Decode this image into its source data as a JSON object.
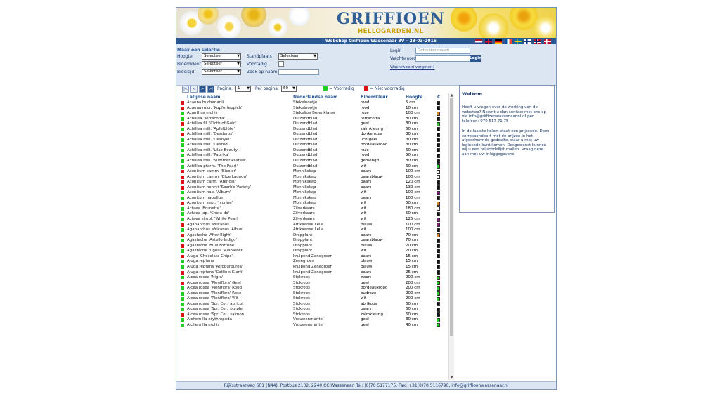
{
  "brand": {
    "logo_main": "GRIFFIOEN",
    "logo_sub": "HELLOGARDEN.NL"
  },
  "shopbar": {
    "title": "Webshop Griffioen Wassenaar BV  –  23-03-2015"
  },
  "flags": [
    "nl",
    "en",
    "de",
    "fr",
    "se",
    "fi",
    "no",
    "dk"
  ],
  "filters": {
    "section_title": "Maak een selectie",
    "hoogte_label": "Hoogte",
    "bloemkleur_label": "Bloemkleur",
    "bloeitijd_label": "Bloeitijd",
    "standplaats_label": "Standplaats",
    "voorradig_label": "Voorradig",
    "zoek_label": "Zoek op naam",
    "select_value": "Selecteer"
  },
  "login": {
    "login_label": "Login",
    "login_placeholder": "Gebruikersnaam",
    "password_label": "Wachtwoord",
    "button": "Login",
    "forgot": "Wachtwoord vergeten?"
  },
  "pager": {
    "first": "|<",
    "prev": "<",
    "next": ">",
    "last": ">|",
    "page_label": "Pagina:",
    "page_value": "1",
    "per_page_label": "Per pagina:",
    "per_page_value": "50",
    "legend_in_stock": "= Voorradig",
    "legend_not_in_stock": "= Niet voorradig",
    "colors": {
      "in_stock": "#22cc22",
      "not_in_stock": "#dd1111"
    }
  },
  "table": {
    "headers": {
      "latin": "Latijnse naam",
      "dutch": "Nederlandse naam",
      "color": "Bloemkleur",
      "height": "Hoogte",
      "extra": "C"
    },
    "rows": [
      {
        "s": "r",
        "latin": "Acaena buchananii",
        "dutch": "Stekelnootje",
        "color": "rood",
        "height": "5 cm",
        "sw": "#111111"
      },
      {
        "s": "r",
        "latin": "Acaena micr. 'Kupferteppich'",
        "dutch": "Stekelnootje",
        "color": "rood",
        "height": "10 cm",
        "sw": "#111111"
      },
      {
        "s": "g",
        "latin": "Acanthus mollis",
        "dutch": "Stekelige Berenklauw",
        "color": "roze",
        "height": "100 cm",
        "sw": "#d98a1a"
      },
      {
        "s": "g",
        "latin": "Achillea 'Terracotta'",
        "dutch": "Duizendblad",
        "color": "terracotta",
        "height": "80 cm",
        "sw": "#111111"
      },
      {
        "s": "r",
        "latin": "Achillea fil. 'Cloth of Gold'",
        "dutch": "Duizendblad",
        "color": "geel",
        "height": "80 cm",
        "sw": "#22cc22"
      },
      {
        "s": "g",
        "latin": "Achillea mill. 'Apfelblüte'",
        "dutch": "Duizendblad",
        "color": "zalmkleurig",
        "height": "50 cm",
        "sw": "#111111"
      },
      {
        "s": "r",
        "latin": "Achillea mill. 'Desderos'",
        "dutch": "Duizendblad",
        "color": "donkerroze",
        "height": "30 cm",
        "sw": "#111111"
      },
      {
        "s": "g",
        "latin": "Achillea mill. 'Deshyel'",
        "dutch": "Duizendblad",
        "color": "lichtgeel",
        "height": "30 cm",
        "sw": "#111111"
      },
      {
        "s": "g",
        "latin": "Achillea mill. 'Desred'",
        "dutch": "Duizendblad",
        "color": "bordeauxrood",
        "height": "30 cm",
        "sw": "#111111"
      },
      {
        "s": "g",
        "latin": "Achillea mill. 'Lilac Beauty'",
        "dutch": "Duizendblad",
        "color": "roze",
        "height": "60 cm",
        "sw": "#111111"
      },
      {
        "s": "g",
        "latin": "Achillea mill. 'Paprika'",
        "dutch": "Duizendblad",
        "color": "rood",
        "height": "50 cm",
        "sw": "#111111"
      },
      {
        "s": "g",
        "latin": "Achillea mill. 'Summer Pastels'",
        "dutch": "Duizendblad",
        "color": "gemengd",
        "height": "80 cm",
        "sw": "#111111"
      },
      {
        "s": "g",
        "latin": "Achillea ptarm. 'The Pearl'",
        "dutch": "Duizendblad",
        "color": "wit",
        "height": "60 cm",
        "sw": "#22cc22"
      },
      {
        "s": "r",
        "latin": "Aconitum camm. 'Bicolor'",
        "dutch": "Monnikskap",
        "color": "paars",
        "height": "100 cm",
        "sw": "#ffffff"
      },
      {
        "s": "r",
        "latin": "Aconitum camm. 'Blue Lagoon'",
        "dutch": "Monnikskap",
        "color": "paarsblauw",
        "height": "100 cm",
        "sw": "#ffffff"
      },
      {
        "s": "r",
        "latin": "Aconitum carm. 'Arendsii'",
        "dutch": "Monnikskap",
        "color": "paars",
        "height": "120 cm",
        "sw": "#111111"
      },
      {
        "s": "r",
        "latin": "Aconitum henryi 'Spark's Variety'",
        "dutch": "Monnikskap",
        "color": "paars",
        "height": "130 cm",
        "sw": "#111111"
      },
      {
        "s": "g",
        "latin": "Aconitum nap. 'Album'",
        "dutch": "Monnikskap",
        "color": "wit",
        "height": "100 cm",
        "sw": "#7b1f7b"
      },
      {
        "s": "g",
        "latin": "Aconitum napellus",
        "dutch": "Monnikskap",
        "color": "paars",
        "height": "100 cm",
        "sw": "#111111"
      },
      {
        "s": "r",
        "latin": "Aconitum sept. 'Ivorine'",
        "dutch": "Monnikskap",
        "color": "wit",
        "height": "50 cm",
        "sw": "#d98a1a"
      },
      {
        "s": "g",
        "latin": "Actaea 'Brunette'",
        "dutch": "Zilverkaars",
        "color": "wit",
        "height": "180 cm",
        "sw": "#ffffff"
      },
      {
        "s": "g",
        "latin": "Actaea jap. 'Cheju-do'",
        "dutch": "Zilverkaars",
        "color": "wit",
        "height": "50 cm",
        "sw": "#111111"
      },
      {
        "s": "g",
        "latin": "Actaea simpl. 'White Pearl'",
        "dutch": "Zilverkaars",
        "color": "wit",
        "height": "125 cm",
        "sw": "#7b1f7b"
      },
      {
        "s": "r",
        "latin": "Agapanthus africanus",
        "dutch": "Afrikaanse Lelie",
        "color": "blauw",
        "height": "100 cm",
        "sw": "#7b1f7b"
      },
      {
        "s": "g",
        "latin": "Agapanthus africanus 'Albus'",
        "dutch": "Afrikaanse Lelie",
        "color": "wit",
        "height": "100 cm",
        "sw": "#111111"
      },
      {
        "s": "r",
        "latin": "Agastache 'After Eight'",
        "dutch": "Dropplant",
        "color": "paars",
        "height": "70 cm",
        "sw": "#d98a1a"
      },
      {
        "s": "g",
        "latin": "Agastache 'Astello Indigo'",
        "dutch": "Dropplant",
        "color": "paarsblauw",
        "height": "70 cm",
        "sw": "#111111"
      },
      {
        "s": "r",
        "latin": "Agastache 'Blue Fortune'",
        "dutch": "Dropplant",
        "color": "blauw",
        "height": "70 cm",
        "sw": "#111111"
      },
      {
        "s": "g",
        "latin": "Agastache rugosa 'Alabaster'",
        "dutch": "Dropplant",
        "color": "wit",
        "height": "70 cm",
        "sw": "#111111"
      },
      {
        "s": "r",
        "latin": "Ajuga 'Chocolate Chips'",
        "dutch": "kruipend Zenegroen",
        "color": "paars",
        "height": "15 cm",
        "sw": "#111111"
      },
      {
        "s": "g",
        "latin": "Ajuga reptans",
        "dutch": "Zenegroen",
        "color": "blauw",
        "height": "15 cm",
        "sw": "#111111"
      },
      {
        "s": "g",
        "latin": "Ajuga reptans 'Atropurpurea'",
        "dutch": "kruipend Zenegroen",
        "color": "blauw",
        "height": "15 cm",
        "sw": "#111111"
      },
      {
        "s": "r",
        "latin": "Ajuga reptans 'Catlin's Giant'",
        "dutch": "kruipend Zenegroen",
        "color": "paars",
        "height": "25 cm",
        "sw": "#111111"
      },
      {
        "s": "g",
        "latin": "Alcea rosea 'Nigra'",
        "dutch": "Stokroos",
        "color": "zwart",
        "height": "200 cm",
        "sw": "#22cc22"
      },
      {
        "s": "r",
        "latin": "Alcea rosea 'Pleniflora' Geel",
        "dutch": "Stokroos",
        "color": "geel",
        "height": "200 cm",
        "sw": "#22cc22"
      },
      {
        "s": "g",
        "latin": "Alcea rosea 'Pleniflora' Rood",
        "dutch": "Stokroos",
        "color": "bordeauxrood",
        "height": "200 cm",
        "sw": "#22cc22"
      },
      {
        "s": "g",
        "latin": "Alcea rosea 'Pleniflora' Rose",
        "dutch": "Stokroos",
        "color": "oudroze",
        "height": "200 cm",
        "sw": "#22cc22"
      },
      {
        "s": "g",
        "latin": "Alcea rosea 'Pleniflora' Wit",
        "dutch": "Stokroos",
        "color": "wit",
        "height": "200 cm",
        "sw": "#22cc22"
      },
      {
        "s": "g",
        "latin": "Alcea rosea 'Spr. Cel.' apricot",
        "dutch": "Stokroos",
        "color": "abrikoos",
        "height": "60 cm",
        "sw": "#111111"
      },
      {
        "s": "g",
        "latin": "Alcea rosea 'Spr. Cel.' purple",
        "dutch": "Stokroos",
        "color": "paars",
        "height": "60 cm",
        "sw": "#111111"
      },
      {
        "s": "r",
        "latin": "Alcea rosea 'Spr. Cel.' salmon",
        "dutch": "Stokroos",
        "color": "zalmkleurig",
        "height": "60 cm",
        "sw": "#111111"
      },
      {
        "s": "g",
        "latin": "Alchemilla erythropoda",
        "dutch": "Vrouwenmantel",
        "color": "geel",
        "height": "30 cm",
        "sw": "#22cc22"
      },
      {
        "s": "g",
        "latin": "Alchemilla mollis",
        "dutch": "Vrouwenmantel",
        "color": "geel",
        "height": "40 cm",
        "sw": "#22cc22"
      }
    ]
  },
  "welcome": {
    "title": "Welkom",
    "p1": "Heeft u vragen over de werking van de webshop? Neemt u dan contact met ons op via info@griffioenwassenaar.nl of per telefoon: 070 517 71 75",
    "p2": "In de laatste kolom staat een prijscode. Deze correspondeert met de prijzen in het afgeschermde gedeelte, waar u met uw logincode kunt komen. Desgewenst kunnen wij u een prijscodelijst mailen. Vraag deze aan met uw inloggegevens."
  },
  "footer": {
    "text": "Rijksstraatweg 601 (N44), Postbus 2102, 2240 CC Wassenaar. Tel: (0)70 5177175, Fax: +31(0)70 5116790, info@griffioenwassenaar.nl"
  }
}
